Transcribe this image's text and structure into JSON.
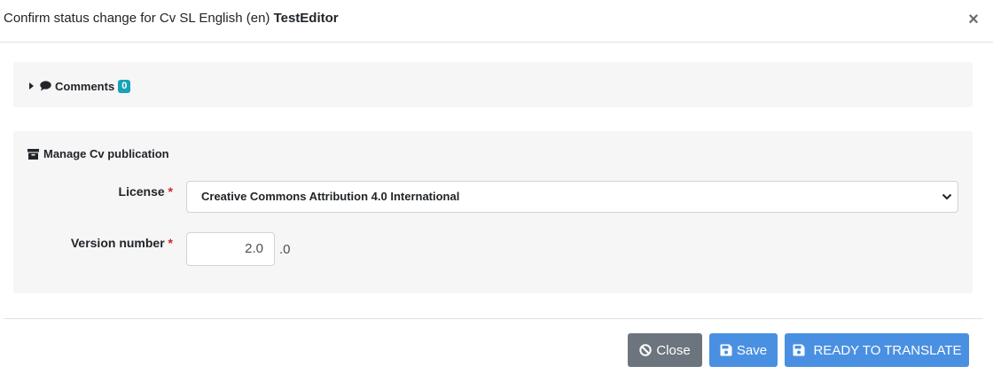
{
  "header": {
    "title_prefix": "Confirm status change for Cv SL English (en) ",
    "title_bold": "TestEditor",
    "close_symbol": "×"
  },
  "comments": {
    "label": "Comments",
    "count": "0",
    "icon": "comment-icon"
  },
  "manage": {
    "title": "Manage Cv publication",
    "icon": "archive-icon",
    "license": {
      "label": "License",
      "required_mark": "*",
      "selected": "Creative Commons Attribution 4.0 International"
    },
    "version": {
      "label": "Version number",
      "required_mark": "*",
      "value": "2.0",
      "suffix": ".0"
    }
  },
  "footer": {
    "close_label": "Close",
    "save_label": "Save",
    "ready_label": "READY TO TRANSLATE"
  },
  "colors": {
    "badge": "#17a2b8",
    "primary": "#4a90e2",
    "secondary": "#6c757d",
    "required": "#d9232d"
  }
}
